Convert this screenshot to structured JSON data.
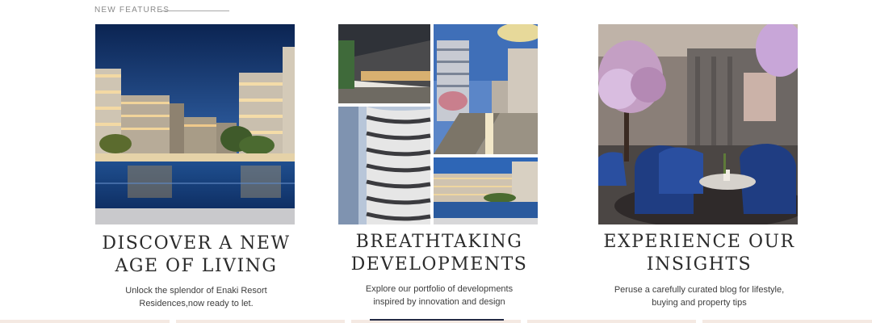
{
  "section": {
    "label": "NEW FEATURES"
  },
  "cards": [
    {
      "title_line1": "DISCOVER A NEW",
      "title_line2": "AGE OF LIVING",
      "desc_line1": "Unlock the splendor of Enaki Resort",
      "desc_line2": "Residences,now ready to let.",
      "image": "resort-pool-night-photo"
    },
    {
      "title_line1": "BREATHTAKING",
      "title_line2": "DEVELOPMENTS",
      "desc_line1": "Explore our portfolio of developments",
      "desc_line2": "inspired by innovation and design",
      "image": "developments-photo-collage"
    },
    {
      "title_line1": "EXPERIENCE OUR",
      "title_line2": "INSIGHTS",
      "desc_line1": "Peruse a carefully curated blog for lifestyle,",
      "desc_line2": "buying and property tips",
      "image": "luxury-lounge-interior-photo"
    }
  ],
  "colors": {
    "title": "#2b2b2b",
    "accent_bar": "#232a44",
    "bottom_strip": "#f4e9e2"
  }
}
